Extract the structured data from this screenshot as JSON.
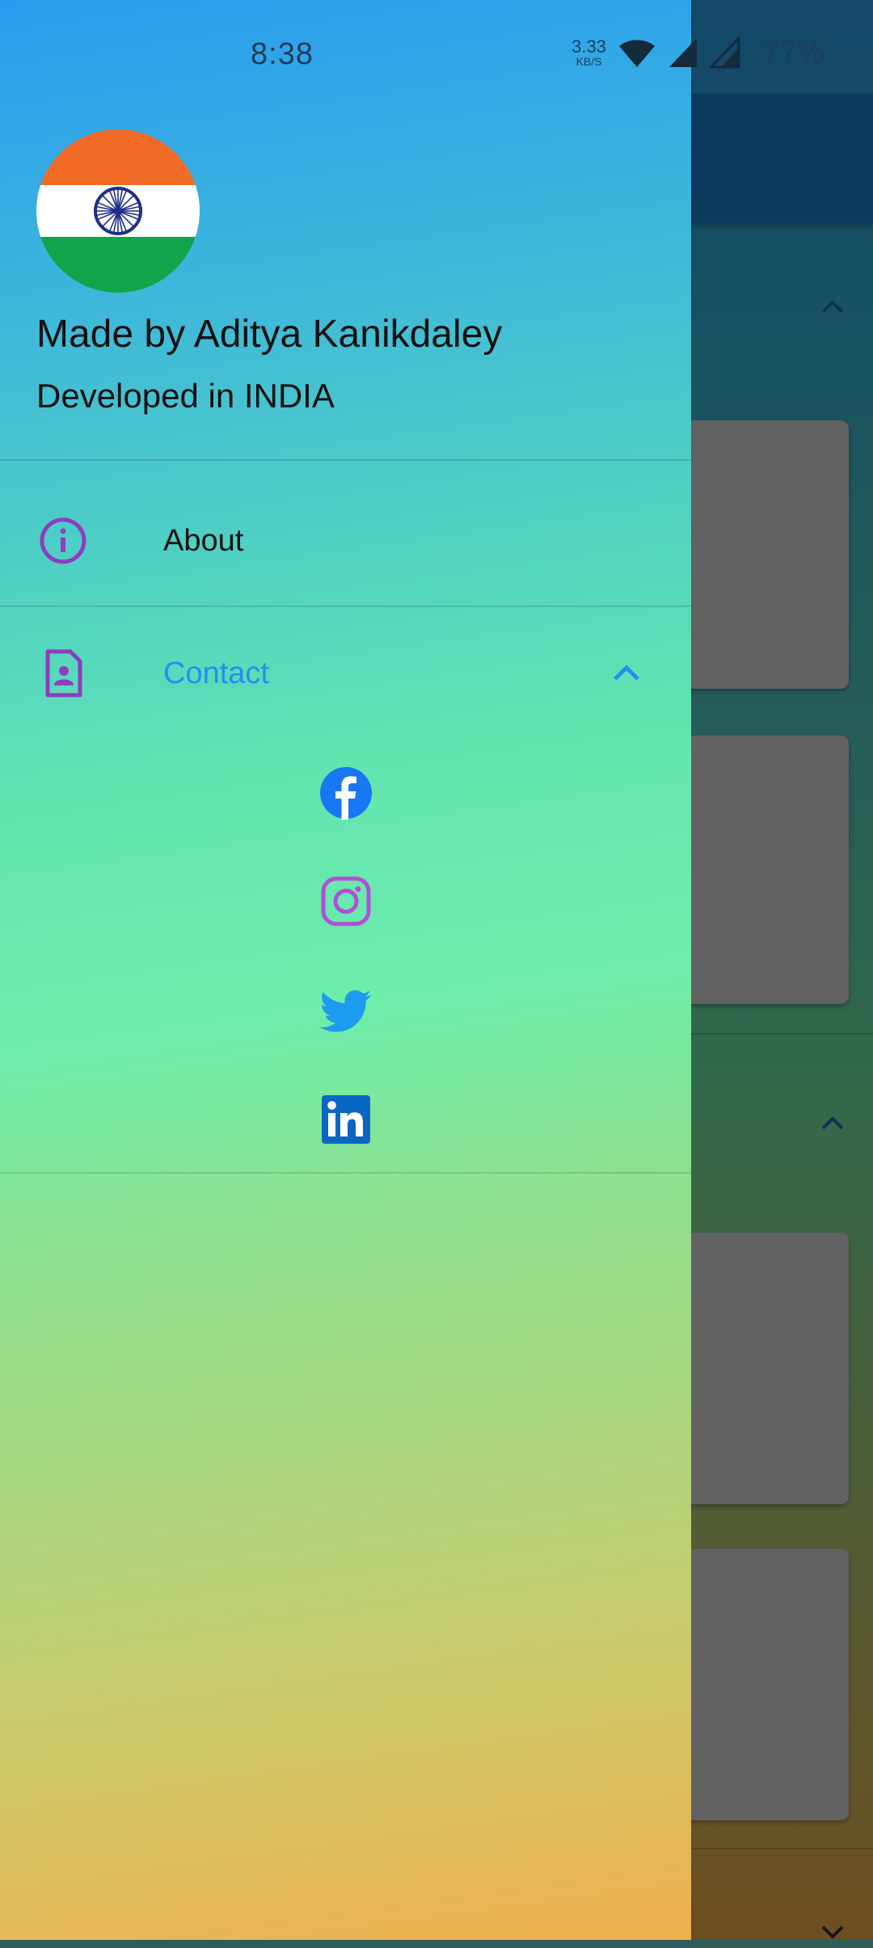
{
  "status_bar": {
    "time": "8:38",
    "net_speed_value": "3.33",
    "net_speed_unit": "KB/S",
    "battery": "77%"
  },
  "drawer": {
    "header": {
      "avatar": "india-flag",
      "name": "Made by Aditya Kanikdaley",
      "subtitle": "Developed in INDIA"
    },
    "items": [
      {
        "icon": "info-icon",
        "label": "About"
      },
      {
        "icon": "contact-card-icon",
        "label": "Contact",
        "expanded": true,
        "accent": "#2a8cf0"
      }
    ],
    "contact_links": [
      {
        "icon": "facebook-icon"
      },
      {
        "icon": "instagram-icon"
      },
      {
        "icon": "twitter-icon"
      },
      {
        "icon": "linkedin-icon"
      }
    ]
  },
  "colors": {
    "icon_purple": "#8e3dbf",
    "accent_blue": "#2a8cf0",
    "facebook_blue": "#1877f2",
    "instagram_purple": "#b34fd6",
    "twitter_blue": "#1d9bf0",
    "linkedin_blue": "#0a66c2"
  }
}
